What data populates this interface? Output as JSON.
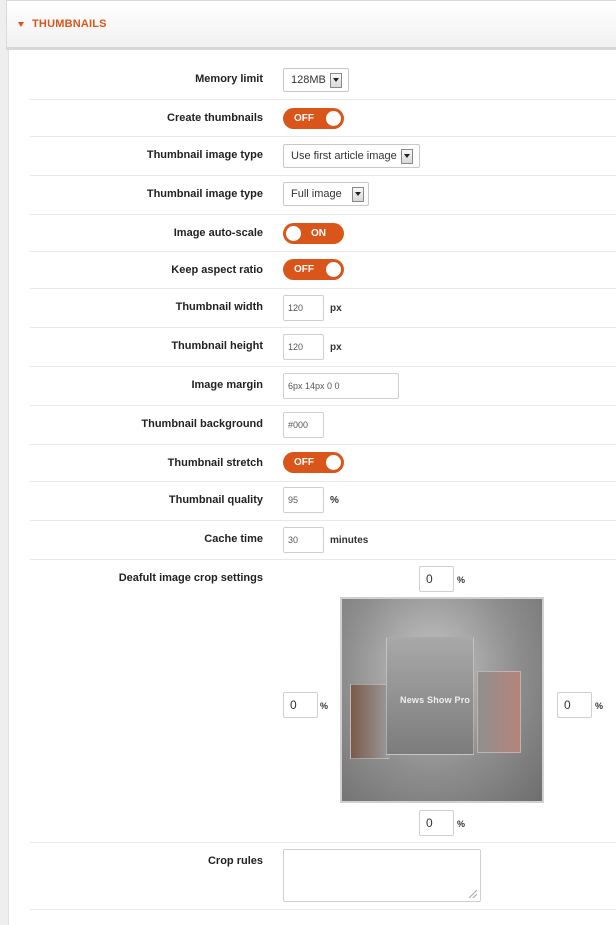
{
  "panel": {
    "title": "THUMBNAILS"
  },
  "memory_limit": {
    "label": "Memory limit",
    "value": "128MB"
  },
  "create_thumbnails": {
    "label": "Create thumbnails",
    "state": "OFF"
  },
  "thumb_type_1": {
    "label": "Thumbnail image type",
    "value": "Use first article image"
  },
  "thumb_type_2": {
    "label": "Thumbnail image type",
    "value": "Full image"
  },
  "auto_scale": {
    "label": "Image auto-scale",
    "state": "ON"
  },
  "keep_aspect": {
    "label": "Keep aspect ratio",
    "state": "OFF"
  },
  "thumb_width": {
    "label": "Thumbnail width",
    "value": "120",
    "unit": "px"
  },
  "thumb_height": {
    "label": "Thumbnail height",
    "value": "120",
    "unit": "px"
  },
  "image_margin": {
    "label": "Image margin",
    "value": "6px 14px 0 0"
  },
  "thumb_bg": {
    "label": "Thumbnail background",
    "value": "#000"
  },
  "thumb_stretch": {
    "label": "Thumbnail stretch",
    "state": "OFF"
  },
  "thumb_quality": {
    "label": "Thumbnail quality",
    "value": "95",
    "unit": "%"
  },
  "cache_time": {
    "label": "Cache time",
    "value": "30",
    "unit": "minutes"
  },
  "crop": {
    "label": "Deafult image crop settings",
    "top": "0",
    "left": "0",
    "right": "0",
    "bottom": "0",
    "unit": "%",
    "preview_title": "News Show Pro"
  },
  "crop_rules": {
    "label": "Crop rules",
    "value": ""
  },
  "colors": {
    "accent": "#d9551a"
  }
}
